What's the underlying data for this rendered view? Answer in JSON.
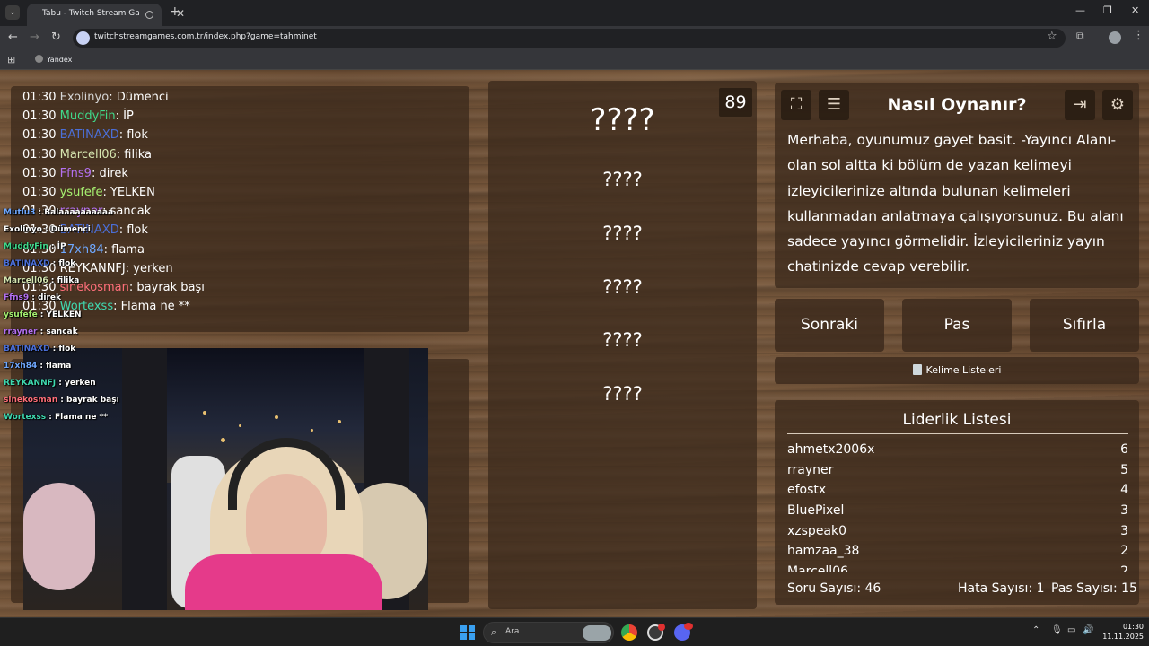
{
  "browser": {
    "tab_title": "Tabu - Twitch Stream Games",
    "url": "twitchstreamgames.com.tr/index.php?game=tahminet",
    "bookmarks": [
      "Yandex"
    ]
  },
  "chat": [
    {
      "time": "01:30",
      "user": "Exolinyo",
      "color": "#d6d6d6",
      "message": "Dümenci"
    },
    {
      "time": "01:30",
      "user": "MuddyFin",
      "color": "#3fd98a",
      "message": "İP"
    },
    {
      "time": "01:30",
      "user": "BATINAXD",
      "color": "#4b6fd8",
      "message": "flok"
    },
    {
      "time": "01:30",
      "user": "Marcell06",
      "color": "#d6e6b0",
      "message": "filika"
    },
    {
      "time": "01:30",
      "user": "Ffns9",
      "color": "#b470f0",
      "message": "direk"
    },
    {
      "time": "01:30",
      "user": "ysufefe",
      "color": "#a6f070",
      "message": "YELKEN"
    },
    {
      "time": "01:30",
      "user": "rrayner",
      "color": "#b470f0",
      "message": "sancak"
    },
    {
      "time": "01:30",
      "user": "BATINAXD",
      "color": "#4b6fd8",
      "message": "flok"
    },
    {
      "time": "01:30",
      "user": "17xh84",
      "color": "#6fa8ff",
      "message": "flama"
    },
    {
      "time": "01:30",
      "user": "REYKANNFJ",
      "color": "#ffffff",
      "message": "yerken"
    },
    {
      "time": "01:30",
      "user": "sinekosman",
      "color": "#ff6f7a",
      "message": "bayrak başı"
    },
    {
      "time": "01:30",
      "user": "Wortexss",
      "color": "#3fd9b0",
      "message": "Flama ne **"
    }
  ],
  "overlay_chat": [
    {
      "user": "Mutlu3",
      "color": "#6fa8ff",
      "message": "Balaaaaaaaaaa"
    },
    {
      "user": "Exolinyo",
      "color": "#ffffff",
      "message": "Dümenci"
    },
    {
      "user": "MuddyFin",
      "color": "#3fd98a",
      "message": "İP"
    },
    {
      "user": "BATINAXD",
      "color": "#4b6fd8",
      "message": "flok"
    },
    {
      "user": "Marcell06",
      "color": "#d6e6b0",
      "message": "filika"
    },
    {
      "user": "Ffns9",
      "color": "#b470f0",
      "message": "direk"
    },
    {
      "user": "ysufefe",
      "color": "#a6f070",
      "message": "YELKEN"
    },
    {
      "user": "rrayner",
      "color": "#b470f0",
      "message": "sancak"
    },
    {
      "user": "BATINAXD",
      "color": "#4b6fd8",
      "message": "flok"
    },
    {
      "user": "17xh84",
      "color": "#6fa8ff",
      "message": "flama"
    },
    {
      "user": "REYKANNFJ",
      "color": "#3fd9b0",
      "message": "yerken"
    },
    {
      "user": "sinekosman",
      "color": "#ff6f7a",
      "message": "bayrak başı"
    },
    {
      "user": "Wortexss",
      "color": "#3fd9b0",
      "message": "Flama ne **"
    }
  ],
  "game": {
    "counter": "89",
    "main_word": "????",
    "forbidden_words": [
      "????",
      "????",
      "????",
      "????",
      "????"
    ]
  },
  "info": {
    "title": "Nasıl Oynanır?",
    "text": "Merhaba, oyunumuz gayet basit. -Yayıncı Alanı- olan sol altta ki bölüm de yazan kelimeyi izleyicilerinize altında bulunan kelimeleri kullanmadan anlatmaya çalışıyorsunuz. Bu alanı sadece yayıncı görmelidir. İzleyicileriniz yayın chatinizde cevap verebilir.",
    "icons": [
      "fullscreen-icon",
      "notes-icon",
      "exit-icon",
      "gear-icon"
    ]
  },
  "buttons": {
    "next": "Sonraki",
    "pass": "Pas",
    "reset": "Sıfırla",
    "word_lists": "Kelime Listeleri"
  },
  "leaderboard": {
    "title": "Liderlik Listesi",
    "rows": [
      {
        "name": "ahmetx2006x",
        "score": "6"
      },
      {
        "name": "rrayner",
        "score": "5"
      },
      {
        "name": "efostx",
        "score": "4"
      },
      {
        "name": "BluePixel",
        "score": "3"
      },
      {
        "name": "xzspeak0",
        "score": "3"
      },
      {
        "name": "hamzaa_38",
        "score": "2"
      },
      {
        "name": "Marcell06",
        "score": "2"
      }
    ]
  },
  "stats": {
    "questions": "Soru Sayısı: 46",
    "errors": "Hata Sayısı: 1",
    "passes": "Pas Sayısı: 15"
  },
  "taskbar": {
    "search_placeholder": "Ara",
    "time": "01:30",
    "date": "11.11.2025"
  }
}
